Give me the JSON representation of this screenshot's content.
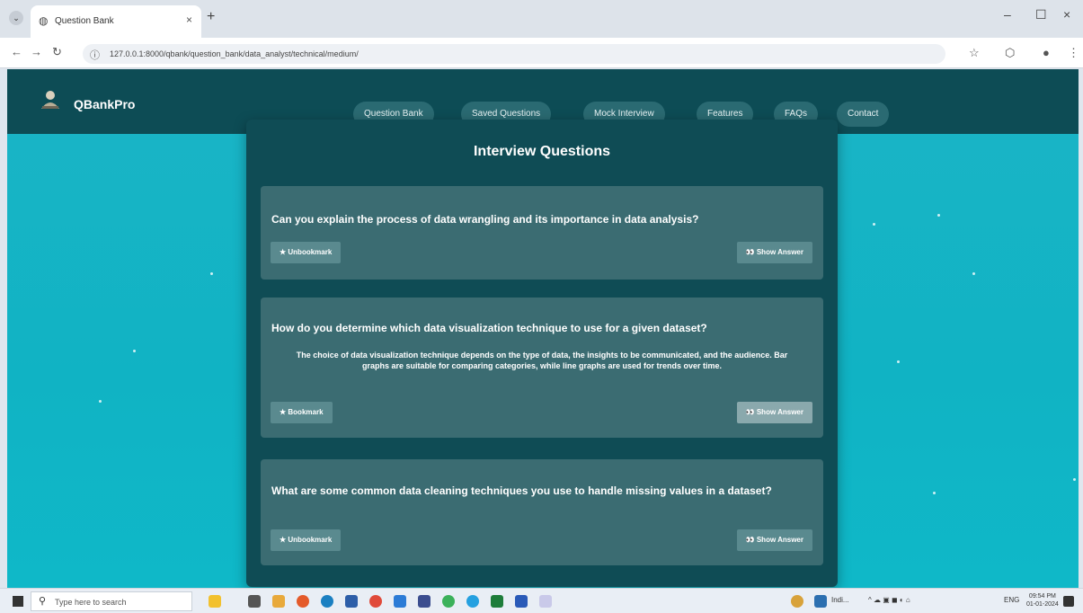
{
  "browser": {
    "tab_title": "Question Bank",
    "tab_close": "×",
    "new_tab": "+",
    "minimize": "–",
    "maximize": "☐",
    "close": "×",
    "url": "127.0.0.1:8000/qbank/question_bank/data_analyst/technical/medium/"
  },
  "site": {
    "brand": "QBankPro",
    "nav": [
      "Question Bank",
      "Saved Questions",
      "Mock Interview",
      "Features",
      "FAQs",
      "Contact"
    ]
  },
  "panel": {
    "title": "Interview Questions",
    "cards": [
      {
        "question": "Can you explain the process of data wrangling and its importance in data analysis?",
        "bookmark_label": "★ Unbookmark",
        "answer_label": "👀 Show Answer",
        "answer": ""
      },
      {
        "question": "How do you determine which data visualization technique to use for a given dataset?",
        "bookmark_label": "★ Bookmark",
        "answer_label": "👀 Show Answer",
        "answer": "The choice of data visualization technique depends on the type of data, the insights to be communicated, and the audience. Bar graphs are suitable for comparing categories, while line graphs are used for trends over time."
      },
      {
        "question": "What are some common data cleaning techniques you use to handle missing values in a dataset?",
        "bookmark_label": "★ Unbookmark",
        "answer_label": "👀 Show Answer",
        "answer": ""
      }
    ]
  },
  "taskbar": {
    "search_placeholder": "Type here to search",
    "tray_weather": "Indi...",
    "language": "ENG",
    "time": "09:54 PM",
    "date": "01-01-2024"
  },
  "colors": {
    "page_bg": "#10b3c4",
    "nav_bg": "#0d4c55",
    "panel_bg": "#0f4c55",
    "card_bg": "#3b6c72",
    "button_bg": "#5a8a8f"
  }
}
